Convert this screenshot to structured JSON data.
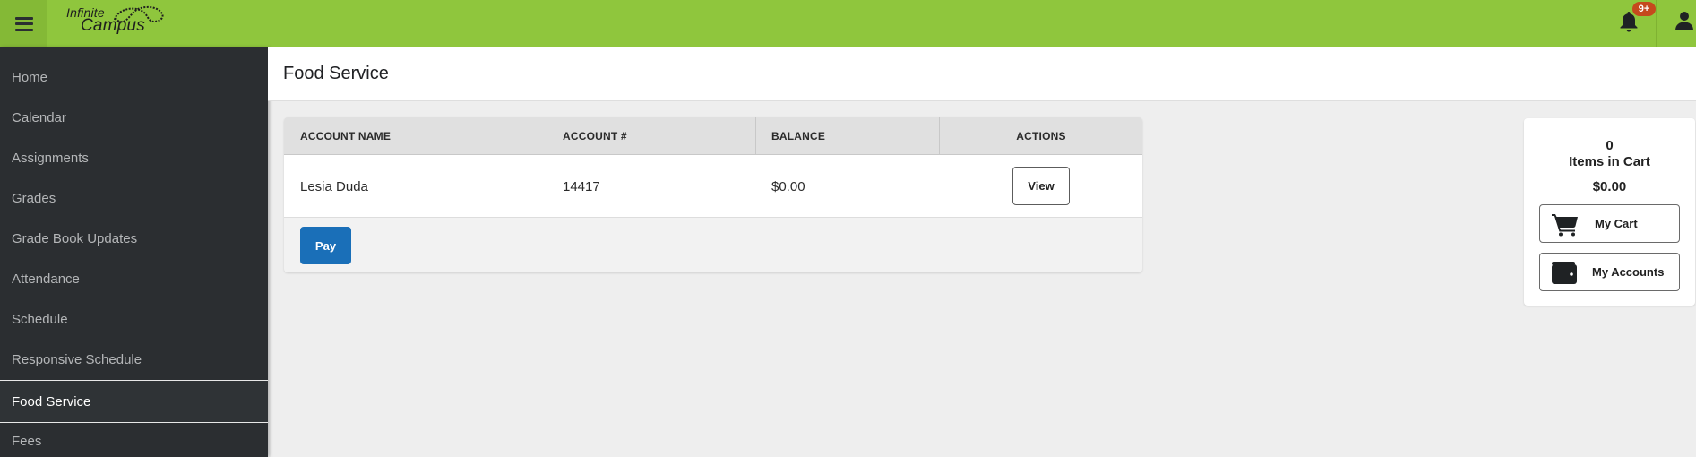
{
  "header": {
    "app_name_line1": "Infinite",
    "app_name_line2": "Campus",
    "notification_badge": "9+",
    "brand_color": "#8fc63d",
    "badge_color": "#c5491d"
  },
  "sidebar": {
    "items": [
      {
        "label": "Home",
        "active": false
      },
      {
        "label": "Calendar",
        "active": false
      },
      {
        "label": "Assignments",
        "active": false
      },
      {
        "label": "Grades",
        "active": false
      },
      {
        "label": "Grade Book Updates",
        "active": false
      },
      {
        "label": "Attendance",
        "active": false
      },
      {
        "label": "Schedule",
        "active": false
      },
      {
        "label": "Responsive Schedule",
        "active": false
      },
      {
        "label": "Food Service",
        "active": true
      },
      {
        "label": "Fees",
        "active": false
      }
    ]
  },
  "page": {
    "title": "Food Service"
  },
  "accounts_table": {
    "columns": [
      "ACCOUNT NAME",
      "ACCOUNT #",
      "BALANCE",
      "ACTIONS"
    ],
    "rows": [
      {
        "account_name": "Lesia Duda",
        "account_number": "14417",
        "balance": "$0.00",
        "action_label": "View"
      }
    ],
    "pay_label": "Pay",
    "pay_color": "#1a6fb8"
  },
  "cart": {
    "count": "0",
    "items_label": "Items in Cart",
    "total": "$0.00",
    "my_cart_label": "My Cart",
    "my_accounts_label": "My Accounts"
  },
  "icons": {
    "menu": "hamburger-menu-icon",
    "notifications": "bell-icon",
    "user": "person-icon",
    "cart": "shopping-cart-icon",
    "accounts": "wallet-icon"
  }
}
